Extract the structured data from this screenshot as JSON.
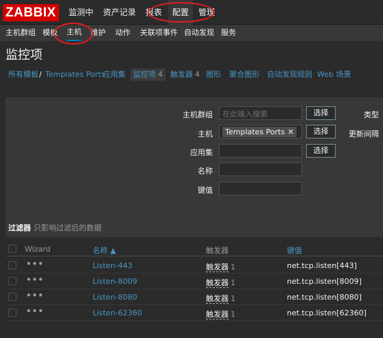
{
  "logo": "ZABBIX",
  "topnav": {
    "items": [
      "监测中",
      "资产记录",
      "报表",
      "配置",
      "管理"
    ]
  },
  "subnav": {
    "items": [
      "主机群组",
      "模板",
      "主机",
      "维护",
      "动作",
      "关联项事件",
      "自动发现",
      "服务"
    ]
  },
  "page_title": "监控项",
  "breadcrumb": {
    "all_templates": "所有模板",
    "separator": "/",
    "template": "Templates Ports",
    "tabs": [
      {
        "label": "应用集",
        "count": ""
      },
      {
        "label": "监控项",
        "count": "4"
      },
      {
        "label": "触发器",
        "count": "4"
      },
      {
        "label": "图形",
        "count": ""
      },
      {
        "label": "聚合图形",
        "count": ""
      },
      {
        "label": "自动发现规则",
        "count": ""
      },
      {
        "label": "Web 场景",
        "count": ""
      }
    ]
  },
  "filter": {
    "host_group_label": "主机群组",
    "host_group_placeholder": "在此输入搜索",
    "host_label": "主机",
    "host_tag": "Templates Ports",
    "app_label": "应用集",
    "name_label": "名称",
    "key_label": "键值",
    "select_button": "选择",
    "type_label": "类型",
    "interval_label": "更新间隔",
    "filter_tab": "过滤器",
    "filter_hint": "只影响过滤后的数据"
  },
  "table": {
    "headers": {
      "wizard": "Wizard",
      "name": "名称 ▲",
      "triggers": "触发器",
      "key": "键值"
    },
    "rows": [
      {
        "wizard": "•••",
        "name": "Listen-443",
        "trigger": "触发器",
        "trigger_count": "1",
        "key": "net.tcp.listen[443]"
      },
      {
        "wizard": "•••",
        "name": "Listen-8009",
        "trigger": "触发器",
        "trigger_count": "1",
        "key": "net.tcp.listen[8009]"
      },
      {
        "wizard": "•••",
        "name": "Listen-8080",
        "trigger": "触发器",
        "trigger_count": "1",
        "key": "net.tcp.listen[8080]"
      },
      {
        "wizard": "•••",
        "name": "Listen-62360",
        "trigger": "触发器",
        "trigger_count": "1",
        "key": "net.tcp.listen[62360]"
      }
    ]
  },
  "colors": {
    "logo_bg": "#d40000",
    "link": "#4796c4",
    "annotation": "#e02020",
    "active_underline": "#0275b8"
  }
}
